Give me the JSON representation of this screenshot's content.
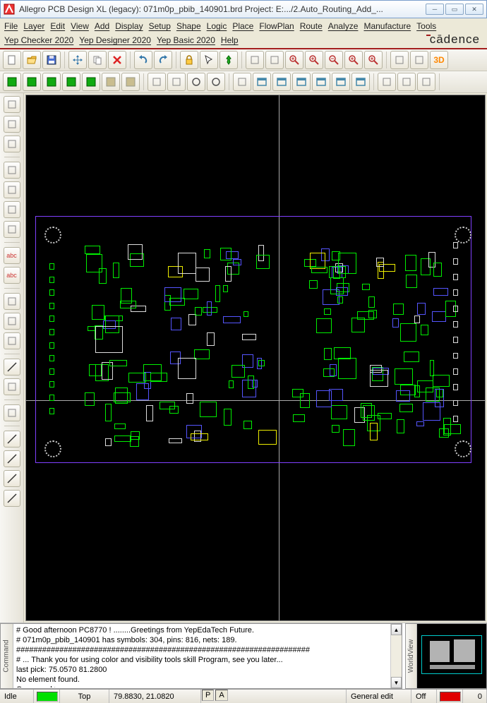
{
  "window": {
    "title": "Allegro PCB Design XL (legacy): 071m0p_pbib_140901.brd  Project: E:.../2.Auto_Routing_Add_..."
  },
  "menus": [
    "File",
    "Layer",
    "Edit",
    "View",
    "Add",
    "Display",
    "Setup",
    "Shape",
    "Logic",
    "Place",
    "FlowPlan",
    "Route",
    "Analyze",
    "Manufacture",
    "Tools",
    "Yep Checker 2020",
    "Yep Designer 2020",
    "Yep Basic 2020",
    "Help"
  ],
  "logo": "cādence",
  "toolbar1_names": [
    "new",
    "open",
    "save",
    "sep",
    "move",
    "copy",
    "delete",
    "sep",
    "undo",
    "redo",
    "sep",
    "lock",
    "cursor",
    "pin",
    "sep",
    "rect-select",
    "red-sel",
    "zoom-in",
    "zoom-fit",
    "zoom-out",
    "zoom-win",
    "zoom-prev",
    "sep",
    "swap",
    "ortho",
    "3d"
  ],
  "toolbar2_names": [
    "grp-a",
    "grp-b",
    "grp-c",
    "grp-d",
    "grp-e",
    "grp-f",
    "grp-g",
    "sep",
    "flag1",
    "flag2",
    "circle1",
    "circle2",
    "sep",
    "sel",
    "panel1",
    "panel2",
    "panel3",
    "panel4",
    "panel5",
    "panel6",
    "sep",
    "block",
    "dim-h",
    "dim-v",
    "sep"
  ],
  "left_tools": [
    "placed",
    "auto",
    "ratsnest",
    "sep",
    "layers",
    "add",
    "route",
    "net",
    "sep",
    "abc",
    "abc2",
    "sep",
    "drc",
    "cross",
    "thermal",
    "sep",
    "line",
    "text",
    "sep",
    "labels",
    "sep",
    "pin1",
    "pin2",
    "pin3",
    "pin4"
  ],
  "console": {
    "lines": [
      "#  Good afternoon PC8770 !      ........Greetings from YepEdaTech Future.",
      "#  071m0p_pbib_140901 has symbols: 304, pins: 816, nets: 189.",
      "####################################################################",
      "# ... Thank you for using color and visibility tools skill Program, see you later...",
      "last pick:  75.0570 81.2800",
      "No element found.",
      "Command >"
    ],
    "tab": "Command",
    "wv_tab": "WorldView"
  },
  "status": {
    "mode": "Idle",
    "layer_color": "#00e000",
    "layer_name": "Top",
    "coords": "79.8830, 21.0820",
    "p": "P",
    "a": "A",
    "edit_mode": "General edit",
    "drc": "Off",
    "drc_color": "#e00000",
    "count": "0"
  }
}
